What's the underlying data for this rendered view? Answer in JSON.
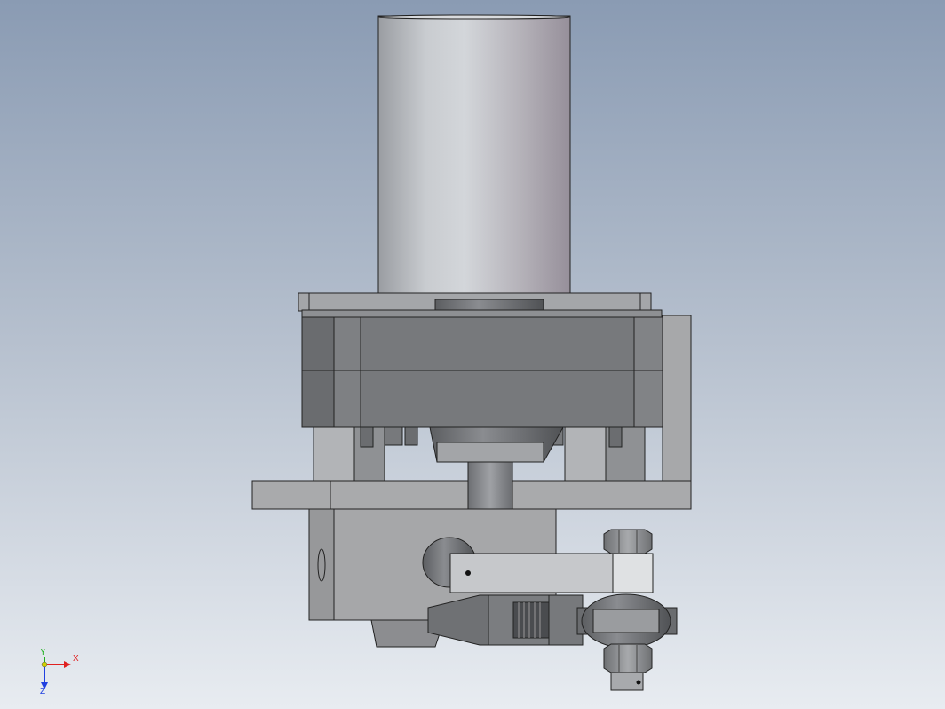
{
  "triad": {
    "x_label": "X",
    "y_label": "Y",
    "z_label": "Z",
    "x_color": "#e02020",
    "y_color": "#20b020",
    "z_color": "#2040e0"
  },
  "colors": {
    "background_top": "#8a9bb3",
    "background_bottom": "#e8ecf1",
    "motor_body": "#c4c7cc",
    "housing": "#7b7d80",
    "bracket": "#a9aaac",
    "rod_end": "#707275",
    "nut": "#8d8f92"
  }
}
